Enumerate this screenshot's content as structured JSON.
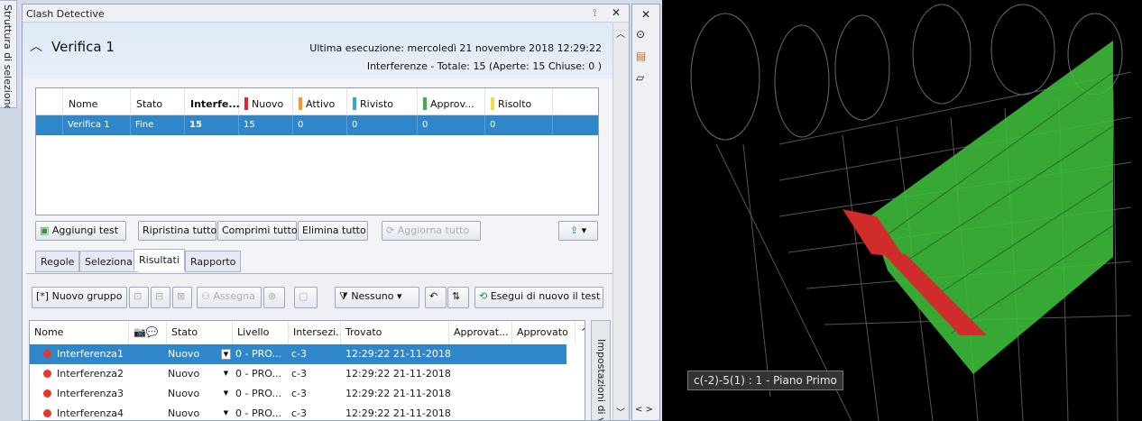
{
  "sidebar_tab": "Struttura di selezione",
  "window": {
    "title": "Clash Detective"
  },
  "header": {
    "test_name": "Verifica 1",
    "last_run": "Ultima esecuzione:  mercoledì 21 novembre 2018 12:29:22",
    "summary": "Interferenze -  Totale:  15  (Aperte:  15  Chiuse:  0 )"
  },
  "test_table": {
    "columns": [
      "Nome",
      "Stato",
      "Interfe...",
      "Nuovo",
      "Attivo",
      "Rivisto",
      "Approv...",
      "Risolto"
    ],
    "column_colors": {
      "Nuovo": "#e2272c",
      "Attivo": "#f39a2b",
      "Rivisto": "#34a7d9",
      "Approv...": "#3fae49",
      "Risolto": "#f2d84a"
    },
    "rows": [
      {
        "nome": "Verifica 1",
        "stato": "Fine",
        "interferenze": "15",
        "nuovo": "15",
        "attivo": "0",
        "rivisto": "0",
        "approvato": "0",
        "risolto": "0"
      }
    ]
  },
  "test_buttons": {
    "add": "Aggiungi test",
    "reset_all": "Ripristina tutto",
    "compact_all": "Comprimi tutto",
    "delete_all": "Elimina tutto",
    "update_all": "Aggiorna tutto"
  },
  "tabs": [
    "Regole",
    "Seleziona",
    "Risultati",
    "Rapporto"
  ],
  "active_tab": "Risultati",
  "results_toolbar": {
    "new_group": "Nuovo gruppo",
    "assign": "Assegna",
    "filter": "Nessuno",
    "rerun": "Esegui di nuovo il test"
  },
  "results_table": {
    "columns": [
      "Nome",
      "Stato",
      "Livello",
      "Intersezi...",
      "Trovato",
      "Approvat...",
      "Approvato"
    ],
    "rows": [
      {
        "nome": "Interferenza1",
        "stato": "Nuovo",
        "livello": "0 - PRO...",
        "intersezione": "c-3",
        "trovato": "12:29:22 21-11-2018"
      },
      {
        "nome": "Interferenza2",
        "stato": "Nuovo",
        "livello": "0 - PRO...",
        "intersezione": "c-3",
        "trovato": "12:29:22 21-11-2018"
      },
      {
        "nome": "Interferenza3",
        "stato": "Nuovo",
        "livello": "0 - PRO...",
        "intersezione": "c-3",
        "trovato": "12:29:22 21-11-2018"
      },
      {
        "nome": "Interferenza4",
        "stato": "Nuovo",
        "livello": "0 - PRO...",
        "intersezione": "c-3",
        "trovato": "12:29:22 21-11-2018"
      }
    ]
  },
  "settings_panel": "Impostazioni di v",
  "viewport": {
    "label": "c(-2)-5(1) : 1 - Piano Primo"
  }
}
